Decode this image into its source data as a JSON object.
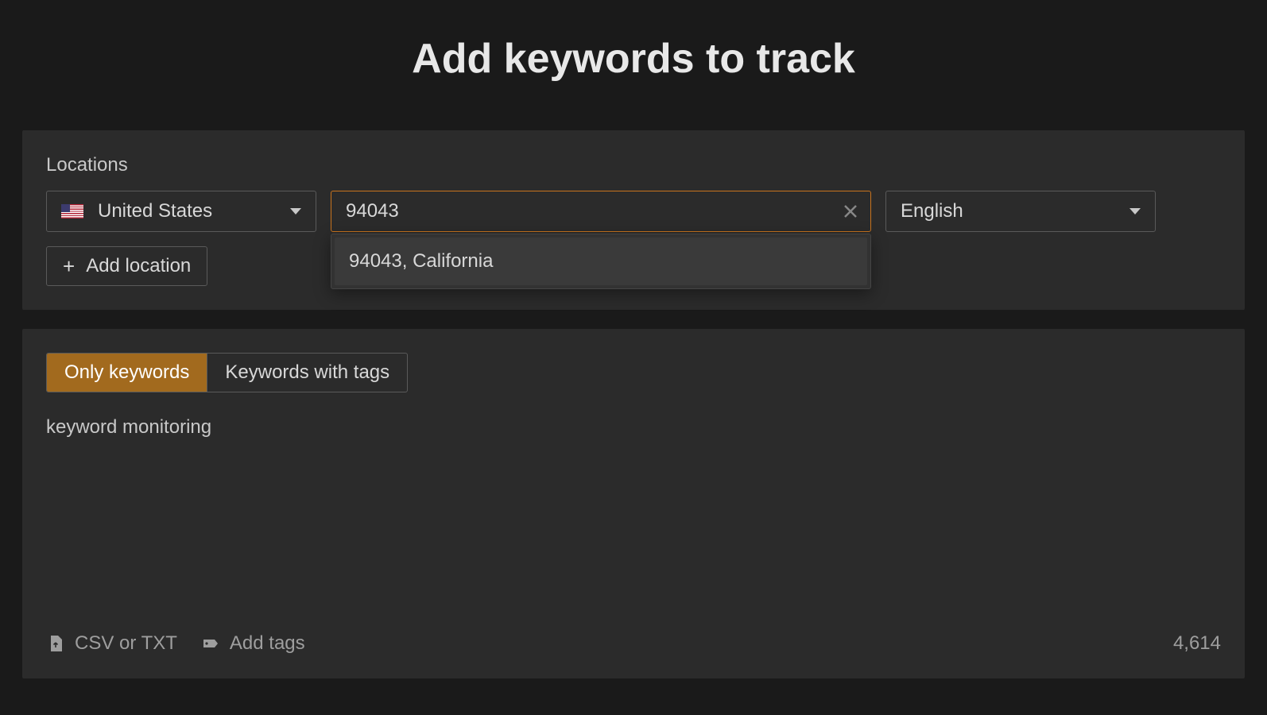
{
  "title": "Add keywords to track",
  "locations": {
    "label": "Locations",
    "country": "United States",
    "search_value": "94043",
    "suggestion": "94043, California",
    "language": "English",
    "add_label": "Add location"
  },
  "keywords": {
    "tabs": {
      "only": "Only keywords",
      "with_tags": "Keywords with tags"
    },
    "content": "keyword monitoring",
    "footer": {
      "upload": "CSV or TXT",
      "tags": "Add tags",
      "count": "4,614"
    }
  }
}
